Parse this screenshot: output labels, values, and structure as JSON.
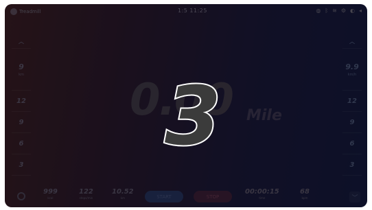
{
  "app": {
    "name": "Treadmill"
  },
  "status_bar": {
    "clock": "1:5 11:25"
  },
  "left_column": {
    "current": "9",
    "sub": "km",
    "ticks": [
      "12",
      "9",
      "6",
      "3"
    ]
  },
  "right_column": {
    "current": "9.9",
    "sub": "km/h",
    "ticks": [
      "12",
      "9",
      "6",
      "3"
    ]
  },
  "main": {
    "distance": "0.00",
    "unit": "Mile"
  },
  "countdown": {
    "value": "3"
  },
  "bottom_bar": {
    "metrics": [
      {
        "value": "999",
        "label": "kcal"
      },
      {
        "value": "122",
        "label": "steps/min"
      },
      {
        "value": "10.52",
        "label": "km"
      },
      {
        "value": "00:00:15",
        "label": "time"
      },
      {
        "value": "68",
        "label": "bpm"
      }
    ],
    "start_label": "START",
    "stop_label": "STOP"
  },
  "icons": [
    "app-logo-icon",
    "gear-icon",
    "chevron-down-icon",
    "wifi-icon",
    "bluetooth-icon",
    "volume-icon"
  ],
  "colors": {
    "countdown_fill": "#3b3b3b",
    "countdown_stroke": "#ffffff",
    "start": "#26345e",
    "stop": "#3d2038"
  }
}
